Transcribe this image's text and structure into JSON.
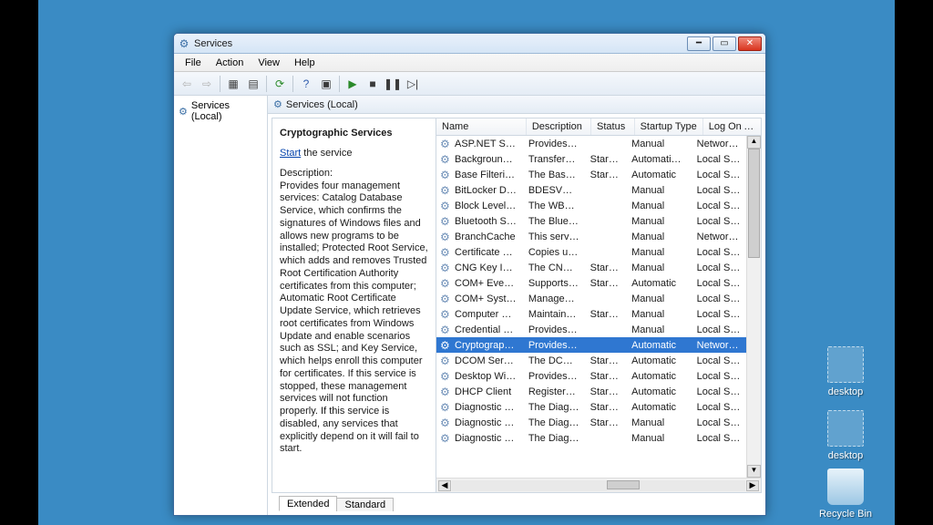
{
  "window": {
    "title": "Services",
    "menu": {
      "file": "File",
      "action": "Action",
      "view": "View",
      "help": "Help"
    }
  },
  "left": {
    "root": "Services (Local)"
  },
  "pane": {
    "title": "Services (Local)"
  },
  "detail": {
    "title": "Cryptographic Services",
    "start_label": "Start",
    "start_suffix": " the service",
    "desc_label": "Description:",
    "desc": "Provides four management services: Catalog Database Service, which confirms the signatures of Windows files and allows new programs to be installed; Protected Root Service, which adds and removes Trusted Root Certification Authority certificates from this computer; Automatic Root Certificate Update Service, which retrieves root certificates from Windows Update and enable scenarios such as SSL; and Key Service, which helps enroll this computer for certificates. If this service is stopped, these management services will not function properly. If this service is disabled, any services that explicitly depend on it will fail to start."
  },
  "columns": {
    "name": "Name",
    "desc": "Description",
    "status": "Status",
    "startup": "Startup Type",
    "logon": "Log On As"
  },
  "rows": [
    {
      "name": "ASP.NET State Ser...",
      "desc": "Provides su...",
      "status": "",
      "startup": "Manual",
      "logon": "Network S..."
    },
    {
      "name": "Background Intelli...",
      "desc": "Transfers fil...",
      "status": "Started",
      "startup": "Automatic (D...",
      "logon": "Local Syste..."
    },
    {
      "name": "Base Filtering Engi...",
      "desc": "The Base Fil...",
      "status": "Started",
      "startup": "Automatic",
      "logon": "Local Service"
    },
    {
      "name": "BitLocker Drive En...",
      "desc": "BDESVC hos...",
      "status": "",
      "startup": "Manual",
      "logon": "Local Syste..."
    },
    {
      "name": "Block Level Backu...",
      "desc": "The WBENG...",
      "status": "",
      "startup": "Manual",
      "logon": "Local Syste..."
    },
    {
      "name": "Bluetooth Support...",
      "desc": "The Bluetoo...",
      "status": "",
      "startup": "Manual",
      "logon": "Local Service"
    },
    {
      "name": "BranchCache",
      "desc": "This service ...",
      "status": "",
      "startup": "Manual",
      "logon": "Network S..."
    },
    {
      "name": "Certificate Propag...",
      "desc": "Copies user ...",
      "status": "",
      "startup": "Manual",
      "logon": "Local Syste..."
    },
    {
      "name": "CNG Key Isolation",
      "desc": "The CNG ke...",
      "status": "Started",
      "startup": "Manual",
      "logon": "Local Syste..."
    },
    {
      "name": "COM+ Event Syst...",
      "desc": "Supports Sy...",
      "status": "Started",
      "startup": "Automatic",
      "logon": "Local Service"
    },
    {
      "name": "COM+ System Ap...",
      "desc": "Manages th...",
      "status": "",
      "startup": "Manual",
      "logon": "Local Syste..."
    },
    {
      "name": "Computer Browser",
      "desc": "Maintains a...",
      "status": "Started",
      "startup": "Manual",
      "logon": "Local Syste..."
    },
    {
      "name": "Credential Manager",
      "desc": "Provides se...",
      "status": "",
      "startup": "Manual",
      "logon": "Local Syste..."
    },
    {
      "name": "Cryptographic Ser...",
      "desc": "Provides fo...",
      "status": "",
      "startup": "Automatic",
      "logon": "Network S...",
      "selected": true
    },
    {
      "name": "DCOM Server Pro...",
      "desc": "The DCOM...",
      "status": "Started",
      "startup": "Automatic",
      "logon": "Local Syste..."
    },
    {
      "name": "Desktop Window ...",
      "desc": "Provides De...",
      "status": "Started",
      "startup": "Automatic",
      "logon": "Local Syste..."
    },
    {
      "name": "DHCP Client",
      "desc": "Registers an...",
      "status": "Started",
      "startup": "Automatic",
      "logon": "Local Service"
    },
    {
      "name": "Diagnostic Policy ...",
      "desc": "The Diagno...",
      "status": "Started",
      "startup": "Automatic",
      "logon": "Local Service"
    },
    {
      "name": "Diagnostic Service...",
      "desc": "The Diagno...",
      "status": "Started",
      "startup": "Manual",
      "logon": "Local Service"
    },
    {
      "name": "Diagnostic System...",
      "desc": "The Diagno...",
      "status": "",
      "startup": "Manual",
      "logon": "Local Syste..."
    }
  ],
  "tabs": {
    "extended": "Extended",
    "standard": "Standard"
  },
  "desktop": {
    "icon1": "desktop",
    "icon2": "desktop",
    "recycle": "Recycle Bin"
  },
  "scroll_indicator": "m"
}
